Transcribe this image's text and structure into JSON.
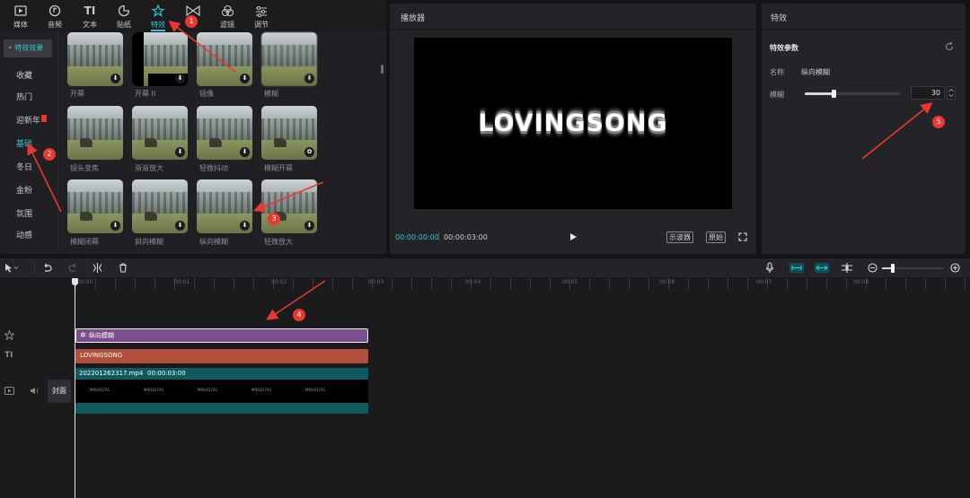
{
  "toolbar": {
    "items": [
      {
        "label": "媒体",
        "icon": "media-icon"
      },
      {
        "label": "音频",
        "icon": "audio-icon"
      },
      {
        "label": "文本",
        "icon": "text-icon"
      },
      {
        "label": "贴纸",
        "icon": "sticker-icon"
      },
      {
        "label": "特效",
        "icon": "effects-icon"
      },
      {
        "label": "",
        "icon": "transition-icon"
      },
      {
        "label": "滤镜",
        "icon": "filter-icon"
      },
      {
        "label": "调节",
        "icon": "adjust-icon"
      }
    ]
  },
  "sidebar": {
    "header": "• 特效效果",
    "items": [
      "收藏",
      "热门",
      "迎新年",
      "基础",
      "冬日",
      "金粉",
      "氛围",
      "动感"
    ],
    "active": "基础"
  },
  "effects": [
    {
      "label": "开幕"
    },
    {
      "label": "开幕 II"
    },
    {
      "label": "镜像"
    },
    {
      "label": "模糊"
    },
    {
      "label": "镜头变焦"
    },
    {
      "label": "渐渐放大"
    },
    {
      "label": "轻微抖动"
    },
    {
      "label": "模糊开幕"
    },
    {
      "label": "模糊闭幕"
    },
    {
      "label": "斜向模糊"
    },
    {
      "label": "纵向模糊"
    },
    {
      "label": "轻微放大"
    }
  ],
  "player": {
    "title": "播放器",
    "preview_text": "LOVINGSONG",
    "current_time": "00:00:00:00",
    "total_time": "00:00:03:00",
    "btn_scope": "示波器",
    "btn_original": "原始"
  },
  "props": {
    "title": "特效",
    "section": "特效参数",
    "name_label": "名称",
    "name_value": "纵向模糊",
    "blur_label": "模糊",
    "blur_value": "30",
    "blur_level": 0.3
  },
  "timeline": {
    "ticks": [
      "00:00",
      "00:01",
      "00:02",
      "00:03",
      "00:04",
      "00:05",
      "00:06",
      "00:07",
      "00:08"
    ],
    "effect_clip": "纵向模糊",
    "text_clip": "LOVINGSONG",
    "video_file": "202201262317.mp4",
    "video_duration": "00:00:03:00",
    "cover_label": "封面",
    "waveform_text": "MRG017A1"
  },
  "annotations": [
    "1",
    "2",
    "3",
    "4",
    "5"
  ],
  "colors": {
    "accent": "#2ec6d0",
    "effect_clip": "#7b4f8f",
    "text_clip": "#b0503c",
    "video_clip": "#0f5a5f",
    "marker": "#e8382f"
  }
}
